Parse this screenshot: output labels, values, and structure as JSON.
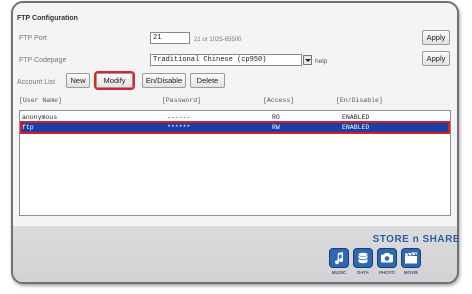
{
  "section_title": "FTP Configuration",
  "ftp_port": {
    "label": "FTP Port",
    "value": "21",
    "hint": "21 or 1025-65500",
    "apply_label": "Apply"
  },
  "ftp_codepage": {
    "label": "FTP Codepage",
    "value": "Traditional Chinese (cp950)",
    "help": "help",
    "apply_label": "Apply"
  },
  "account_list": {
    "label": "Account List",
    "buttons": {
      "new": "New",
      "modify": "Modify",
      "enable": "En/Disable",
      "delete": "Delete"
    },
    "headers": {
      "user": "[User Name]",
      "password": "[Password]",
      "access": "[Access]",
      "status": "[En/Disable]"
    },
    "rows": [
      {
        "user": "anonymous",
        "password": "------",
        "access": "RO",
        "status": "ENABLED",
        "selected": false
      },
      {
        "user": "ftp",
        "password": "******",
        "access": "RW",
        "status": "ENABLED",
        "selected": true
      }
    ]
  },
  "brand": {
    "title": "STORE n SHARE",
    "tiles": [
      {
        "icon": "music-icon",
        "label": "MUSIC"
      },
      {
        "icon": "data-icon",
        "label": "DATA"
      },
      {
        "icon": "photo-icon",
        "label": "PHOTO"
      },
      {
        "icon": "movie-icon",
        "label": "MOVIE"
      }
    ]
  },
  "colors": {
    "selected_row": "#1b3fa5",
    "highlight": "#e0202a",
    "brand": "#2e68b5"
  }
}
